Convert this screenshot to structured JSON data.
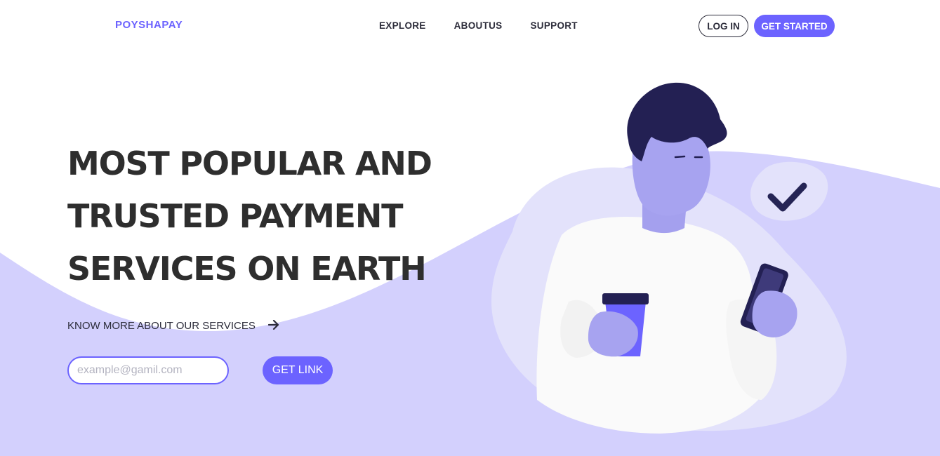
{
  "brand": {
    "logo": "POYSHAPAY",
    "accent_color": "#6c63ff",
    "wave_color": "#d3d0fd"
  },
  "nav": {
    "items": [
      {
        "label": "EXPLORE"
      },
      {
        "label": "ABOUTUS"
      },
      {
        "label": "SUPPORT"
      }
    ]
  },
  "header_actions": {
    "login_label": "LOG IN",
    "get_started_label": "GET STARTED"
  },
  "hero": {
    "title_lines": [
      "MOST POPULAR AND",
      "TRUSTED PAYMENT",
      "SERVICES ON EARTH"
    ],
    "know_more_label": "KNOW MORE ABOUT OUR SERVICES",
    "know_more_icon": "arrow-right-icon",
    "email_placeholder": "example@gamil.com",
    "get_link_label": "GET LINK"
  },
  "illustration": {
    "subject": "person-holding-phone-and-coffee",
    "badge_icon": "checkmark-icon"
  }
}
